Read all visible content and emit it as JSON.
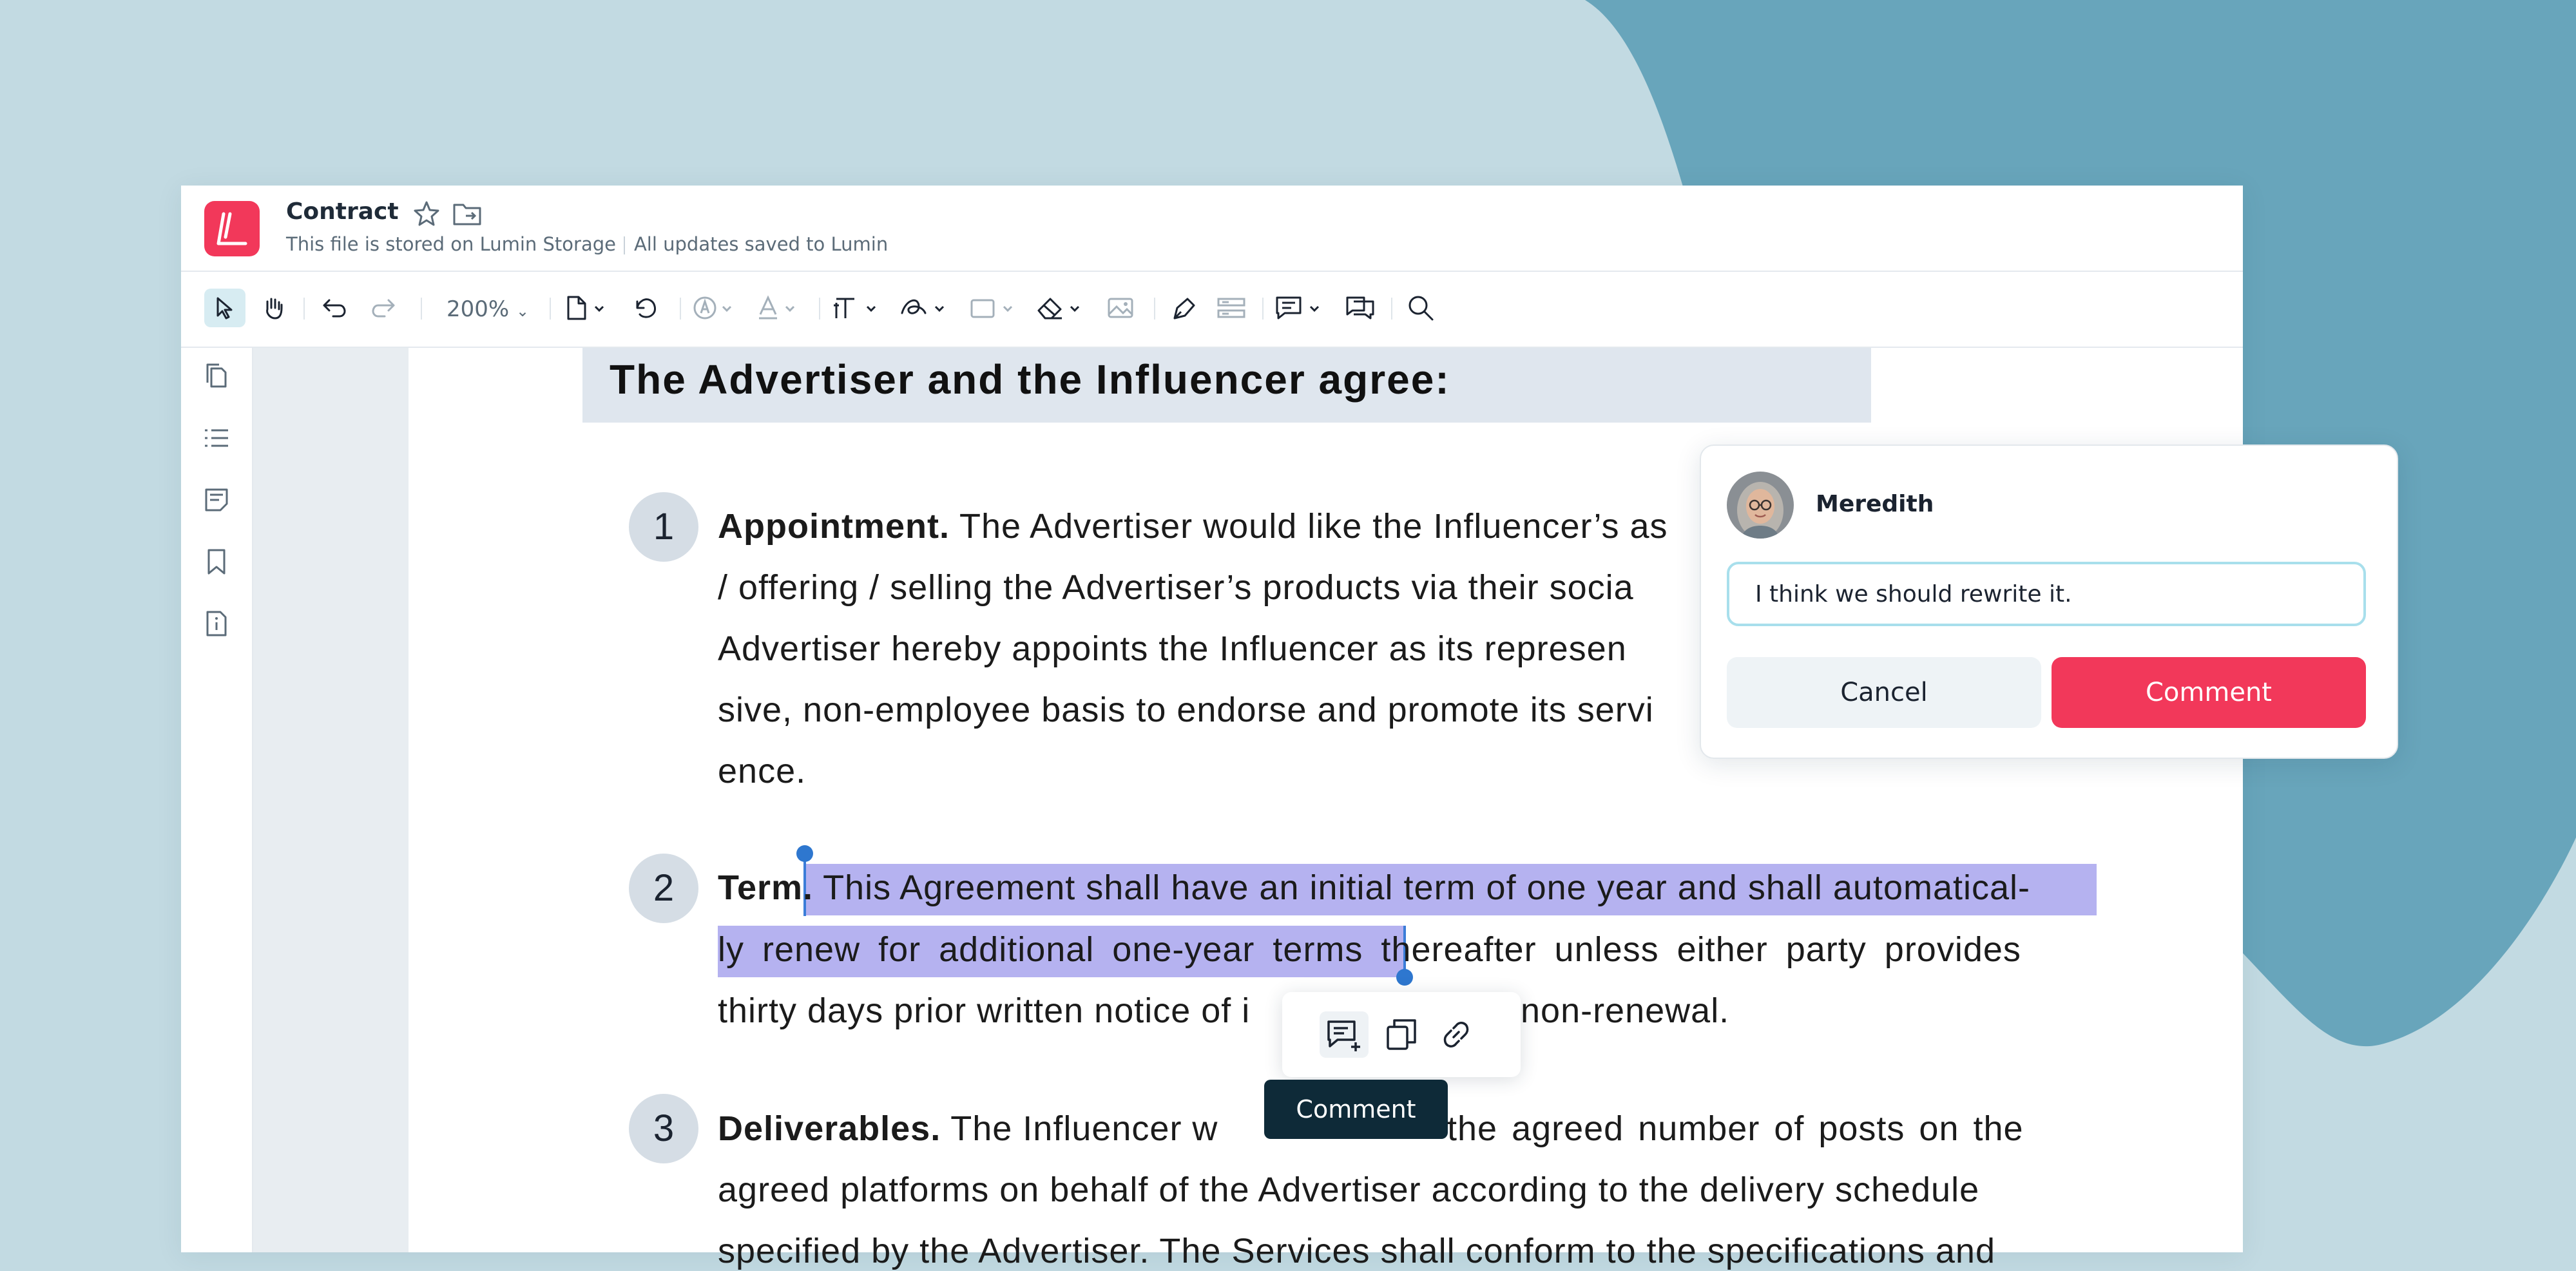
{
  "header": {
    "title": "Contract",
    "storage_note": "This file is stored on Lumin Storage",
    "save_status": "All updates saved to Lumin"
  },
  "toolbar": {
    "zoom_level": "200%",
    "tools": [
      "select-tool-icon",
      "hand-tool-icon",
      "undo-icon",
      "redo-icon",
      "page-icon",
      "rotate-icon",
      "stamp-icon",
      "text-color-icon",
      "text-tool-icon",
      "signature-icon",
      "shape-icon",
      "eraser-icon",
      "image-icon",
      "pen-icon",
      "form-icon",
      "add-comment-icon",
      "comments-icon",
      "search-icon"
    ]
  },
  "sidebar": {
    "icons": [
      "pages-icon",
      "outline-icon",
      "notes-icon",
      "bookmark-icon",
      "file-info-icon"
    ]
  },
  "document": {
    "heading": "The Advertiser and the Influencer agree:",
    "clauses": [
      {
        "number": "1",
        "title": "Appointment.",
        "lines": [
          " The Advertiser would like the Influencer’s as",
          "/ offering / selling the Advertiser’s products via their socia",
          "Advertiser hereby appoints the Influencer as its represen",
          "sive, non-employee basis to endorse and promote its servi",
          "ence."
        ]
      },
      {
        "number": "2",
        "title": "Term.",
        "lines": [
          " This Agreement shall have an initial term of one year and shall automatical-",
          "ly renew for additional one-year terms thereafter unless either party provides",
          "thirty days prior written notice of i",
          "non-renewal."
        ]
      },
      {
        "number": "3",
        "title": "Deliverables.",
        "lines": [
          " The Influencer w",
          "the agreed number of posts on the",
          "agreed platforms on behalf of the Advertiser according to the delivery schedule",
          "specified by the Advertiser. The Services shall conform to the specifications and"
        ]
      }
    ]
  },
  "selection_popup": {
    "tooltip": "Comment"
  },
  "comment_card": {
    "user_name": "Meredith",
    "input_value": "I think we should rewrite it.",
    "cancel_label": "Cancel",
    "submit_label": "Comment"
  },
  "colors": {
    "background": "#c2dae2",
    "blob": "#68a5bb",
    "accent": "#f2385a",
    "highlight": "#b5b2f0",
    "tooltip": "#0e2a38"
  }
}
